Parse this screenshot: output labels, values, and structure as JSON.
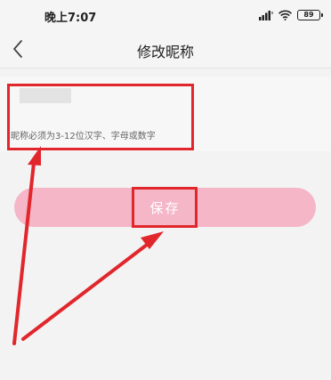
{
  "status_bar": {
    "time": "晚上7:07",
    "battery": "89"
  },
  "nav": {
    "title": "修改昵称"
  },
  "form": {
    "nickname_value": "",
    "hint": "昵称必须为3-12位汉字、字母或数字"
  },
  "actions": {
    "save_label": "保存"
  },
  "colors": {
    "save_button": "#f5b6c7",
    "annotation": "#e1262c"
  },
  "icons": {
    "back": "chevron-left-icon",
    "signal": "signal-icon",
    "wifi": "wifi-icon",
    "battery": "battery-icon"
  }
}
